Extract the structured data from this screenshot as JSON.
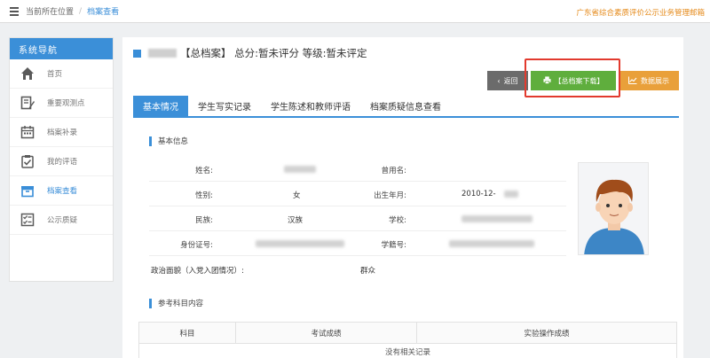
{
  "topbar": {
    "breadcrumb_location": "当前所在位置",
    "breadcrumb_sep": "/",
    "breadcrumb_current": "档案查看",
    "system_title": "广东省综合素质评价公示业务管理邮箱"
  },
  "sidebar": {
    "header": "系统导航",
    "items": [
      {
        "label": "首页",
        "icon": "home-icon"
      },
      {
        "label": "重要观测点",
        "icon": "edit-icon"
      },
      {
        "label": "档案补录",
        "icon": "calendar-icon"
      },
      {
        "label": "我的评语",
        "icon": "clipboard-check-icon"
      },
      {
        "label": "档案查看",
        "icon": "archive-box-icon",
        "active": true
      },
      {
        "label": "公示质疑",
        "icon": "list-check-icon"
      }
    ]
  },
  "main": {
    "title": "【总档案】 总分:暂未评分 等级:暂未评定",
    "buttons": {
      "back": "返回",
      "download": "【总档案下载】",
      "data": "数据展示"
    },
    "tabs": [
      {
        "label": "基本情况",
        "active": true
      },
      {
        "label": "学生写实记录"
      },
      {
        "label": "学生陈述和教师评语"
      },
      {
        "label": "档案质疑信息查看"
      }
    ],
    "basic_info": {
      "section_title": "基本信息",
      "name_label": "姓名:",
      "former_name_label": "曾用名:",
      "gender_label": "性别:",
      "gender_value": "女",
      "birth_label": "出生年月:",
      "birth_value": "2010-12-",
      "ethnicity_label": "民族:",
      "ethnicity_value": "汉族",
      "school_label": "学校:",
      "id_label": "身份证号:",
      "student_no_label": "学籍号:",
      "political_label": "政治面貌（入党入团情况）:",
      "political_value": "群众"
    },
    "reference": {
      "section_title": "参考科目内容",
      "columns": [
        "科目",
        "考试成绩",
        "实验操作成绩"
      ],
      "empty_text": "没有相关记录"
    }
  },
  "colors": {
    "primary": "#3b8fd8",
    "download_green": "#5fae3d",
    "data_orange": "#e9a03a",
    "back_gray": "#6b6b6b",
    "highlight_red": "#e23a2e",
    "system_title_orange": "#e58a1a"
  }
}
